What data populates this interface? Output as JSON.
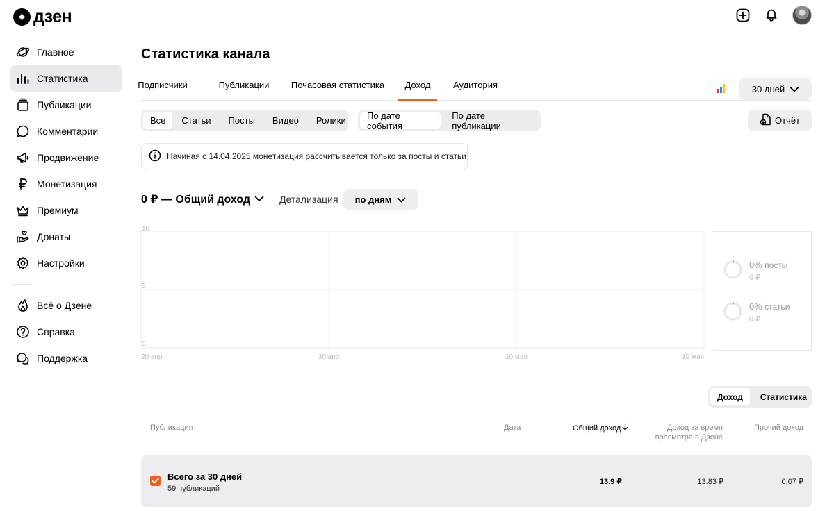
{
  "brand": {
    "name": "дзен"
  },
  "sidebar": {
    "items": [
      {
        "label": "Главное",
        "icon": "planet-icon"
      },
      {
        "label": "Статистика",
        "icon": "bar-chart-icon",
        "active": true
      },
      {
        "label": "Публикации",
        "icon": "publications-icon"
      },
      {
        "label": "Комментарии",
        "icon": "comment-icon"
      },
      {
        "label": "Продвижение",
        "icon": "megaphone-icon"
      },
      {
        "label": "Монетизация",
        "icon": "ruble-icon"
      },
      {
        "label": "Премиум",
        "icon": "crown-icon"
      },
      {
        "label": "Донаты",
        "icon": "donate-hand-icon"
      },
      {
        "label": "Настройки",
        "icon": "gear-icon"
      }
    ],
    "secondary": [
      {
        "label": "Всё о Дзене",
        "icon": "flame-icon"
      },
      {
        "label": "Справка",
        "icon": "help-icon"
      },
      {
        "label": "Поддержка",
        "icon": "support-chat-icon"
      }
    ]
  },
  "page": {
    "title": "Статистика канала"
  },
  "tabs": [
    "Подписчики",
    "Публикации",
    "Почасовая статистика",
    "Доход",
    "Аудитория"
  ],
  "active_tab": "Доход",
  "period": {
    "label": "30 дней"
  },
  "content_filter": {
    "options": [
      "Все",
      "Статьи",
      "Посты",
      "Видео",
      "Ролики"
    ],
    "selected": "Все"
  },
  "date_filter": {
    "options": [
      "По дате события",
      "По дате публикации"
    ],
    "selected": "По дате события"
  },
  "report_button": {
    "label": "Отчёт"
  },
  "notice": {
    "text": "Начиная с 14.04.2025 монетизация рассчитывается только за посты и статьи"
  },
  "total": {
    "label": "0 ₽ — Общий доход"
  },
  "detail": {
    "label": "Детализация",
    "value": "по дням"
  },
  "chart_data": {
    "type": "line",
    "y_ticks": [
      "10",
      "5",
      "0"
    ],
    "ylim": [
      0,
      10
    ],
    "x_ticks": [
      "20 апр",
      "30 апр",
      "10 мая",
      "19 мая"
    ],
    "series": [],
    "grid": true
  },
  "breakdown": [
    {
      "percent": "0%",
      "label": "посты",
      "amount": "0 ₽"
    },
    {
      "percent": "0%",
      "label": "статьи",
      "amount": "0 ₽"
    }
  ],
  "table_toggle": {
    "options": [
      "Доход",
      "Статистика"
    ],
    "selected": "Доход"
  },
  "table": {
    "headers": {
      "publication": "Публикация",
      "date": "Дата",
      "total": "Общий доход",
      "view_income_1": "Доход за время",
      "view_income_2": "просмотра в Дзене",
      "other": "Прочий доход"
    },
    "summary": {
      "title": "Всего за 30 дней",
      "subtitle": "59 публикаций",
      "total": "13.9 ₽",
      "view_income": "13.83 ₽",
      "other": "0.07 ₽"
    }
  },
  "colors": {
    "accent": "#f45c1d",
    "chip_bg": "#eeeef0",
    "active_nav": "#eaeaec"
  }
}
